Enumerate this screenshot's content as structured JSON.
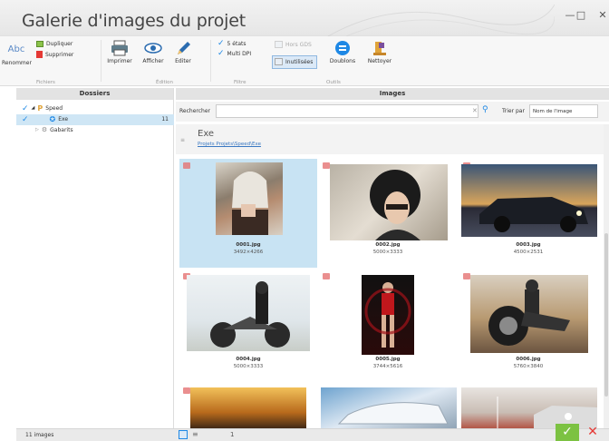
{
  "window": {
    "title": "Galerie d'images du projet",
    "minimize": "—",
    "maximize": "□",
    "close": "✕"
  },
  "ribbon": {
    "groups": {
      "fichiers": "Fichiers",
      "edition": "Édition",
      "filtre": "Filtre",
      "outils": "Outils"
    },
    "buttons": {
      "renommer": "Renommer",
      "dupliquer": "Dupliquer",
      "supprimer": "Supprimer",
      "imprimer": "Imprimer",
      "afficher": "Afficher",
      "editer": "Editer",
      "doublons": "Doublons",
      "nettoyer": "Nettoyer",
      "abc": "Abc"
    },
    "filters": {
      "f1": "5 états",
      "f2": "Multi DPI",
      "f3": "Hors GDS",
      "f4": "Inutilisées"
    }
  },
  "sidebar": {
    "title": "Dossiers",
    "tree": [
      {
        "label": "Speed",
        "count": ""
      },
      {
        "label": "Exe",
        "count": "11"
      },
      {
        "label": "Gabarits",
        "count": ""
      }
    ]
  },
  "main": {
    "title": "Images",
    "search_label": "Rechercher",
    "search_value": "",
    "sort_label": "Trier par",
    "sort_value": "Nom de l'image",
    "folder_name": "Exe",
    "folder_path": "Projets Projets\\Speed\\Exe",
    "items": [
      {
        "name": "0001.jpg",
        "size": "3492×4266"
      },
      {
        "name": "0002.jpg",
        "size": "5000×3333"
      },
      {
        "name": "0003.jpg",
        "size": "4500×2531"
      },
      {
        "name": "0004.jpg",
        "size": "5000×3333"
      },
      {
        "name": "0005.jpg",
        "size": "3744×5616"
      },
      {
        "name": "0006.jpg",
        "size": "5760×3840"
      },
      {
        "name": "",
        "size": ""
      },
      {
        "name": "",
        "size": ""
      },
      {
        "name": "",
        "size": ""
      }
    ]
  },
  "status": {
    "count": "11 images",
    "page": "1",
    "ok": "✓",
    "cancel": "✕"
  },
  "colors": {
    "accent": "#1e88e5",
    "selection": "#c8e3f3",
    "ok": "#7cc242",
    "cancel": "#e53935"
  }
}
